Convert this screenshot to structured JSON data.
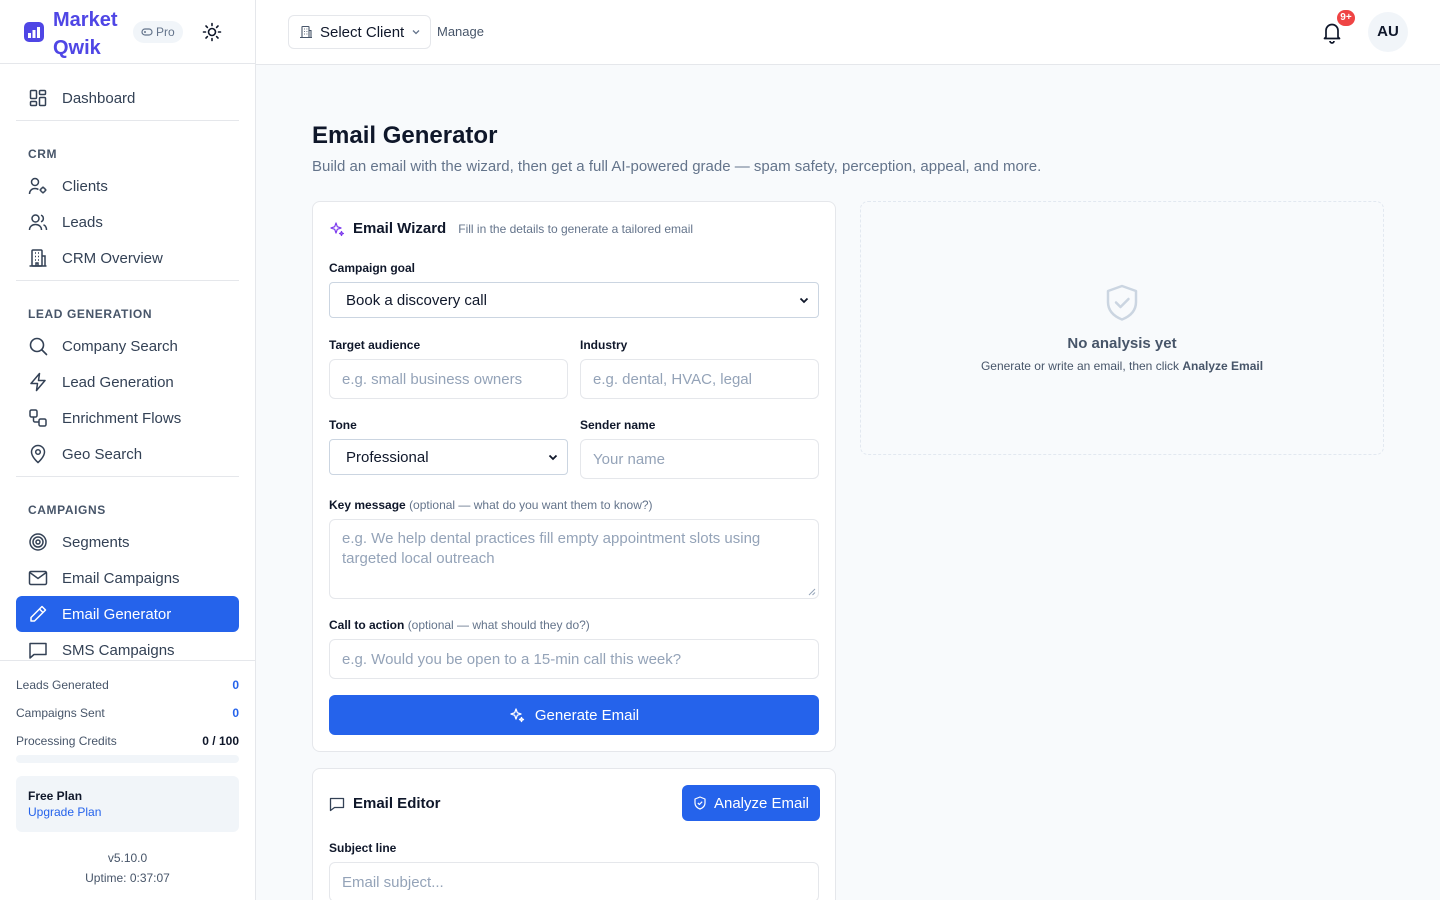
{
  "brand": {
    "name": "Market Qwik",
    "badge": "Pro"
  },
  "nav": {
    "dashboard": "Dashboard",
    "sections": {
      "crm": "CRM",
      "lead_generation": "LEAD GENERATION",
      "campaigns": "CAMPAIGNS"
    },
    "crm_items": [
      "Clients",
      "Leads",
      "CRM Overview"
    ],
    "lead_items": [
      "Company Search",
      "Lead Generation",
      "Enrichment Flows",
      "Geo Search"
    ],
    "campaign_items": [
      "Segments",
      "Email Campaigns",
      "Email Generator",
      "SMS Campaigns"
    ],
    "active": "Email Generator"
  },
  "stats": {
    "leads_generated_label": "Leads Generated",
    "leads_generated_value": "0",
    "campaigns_sent_label": "Campaigns Sent",
    "campaigns_sent_value": "0",
    "credits_label": "Processing Credits",
    "credits_value": "0 / 100",
    "credits_fraction": 0
  },
  "plan": {
    "title": "Free Plan",
    "link": "Upgrade Plan"
  },
  "footer": {
    "version": "v5.10.0",
    "uptime": "Uptime: 0:37:07"
  },
  "topbar": {
    "client_select": "Select Client",
    "manage": "Manage",
    "notification_count": "9+",
    "avatar": "AU"
  },
  "page": {
    "title": "Email Generator",
    "subtitle": "Build an email with the wizard, then get a full AI-powered grade — spam safety, perception, appeal, and more."
  },
  "wizard": {
    "title": "Email Wizard",
    "subtitle": "Fill in the details to generate a tailored email",
    "campaign_goal_label": "Campaign goal",
    "campaign_goal_value": "Book a discovery call",
    "target_audience_label": "Target audience",
    "target_audience_placeholder": "e.g. small business owners",
    "industry_label": "Industry",
    "industry_placeholder": "e.g. dental, HVAC, legal",
    "tone_label": "Tone",
    "tone_value": "Professional",
    "sender_label": "Sender name",
    "sender_placeholder": "Your name",
    "key_message_label": "Key message",
    "key_message_hint": "(optional — what do you want them to know?)",
    "key_message_placeholder": "e.g. We help dental practices fill empty appointment slots using targeted local outreach",
    "cta_label": "Call to action",
    "cta_hint": "(optional — what should they do?)",
    "cta_placeholder": "e.g. Would you be open to a 15-min call this week?",
    "generate_button": "Generate Email"
  },
  "editor": {
    "title": "Email Editor",
    "analyze_button": "Analyze Email",
    "subject_label": "Subject line",
    "subject_placeholder": "Email subject..."
  },
  "analysis": {
    "title": "No analysis yet",
    "subtitle_prefix": "Generate or write an email, then click ",
    "subtitle_bold": "Analyze Email"
  }
}
